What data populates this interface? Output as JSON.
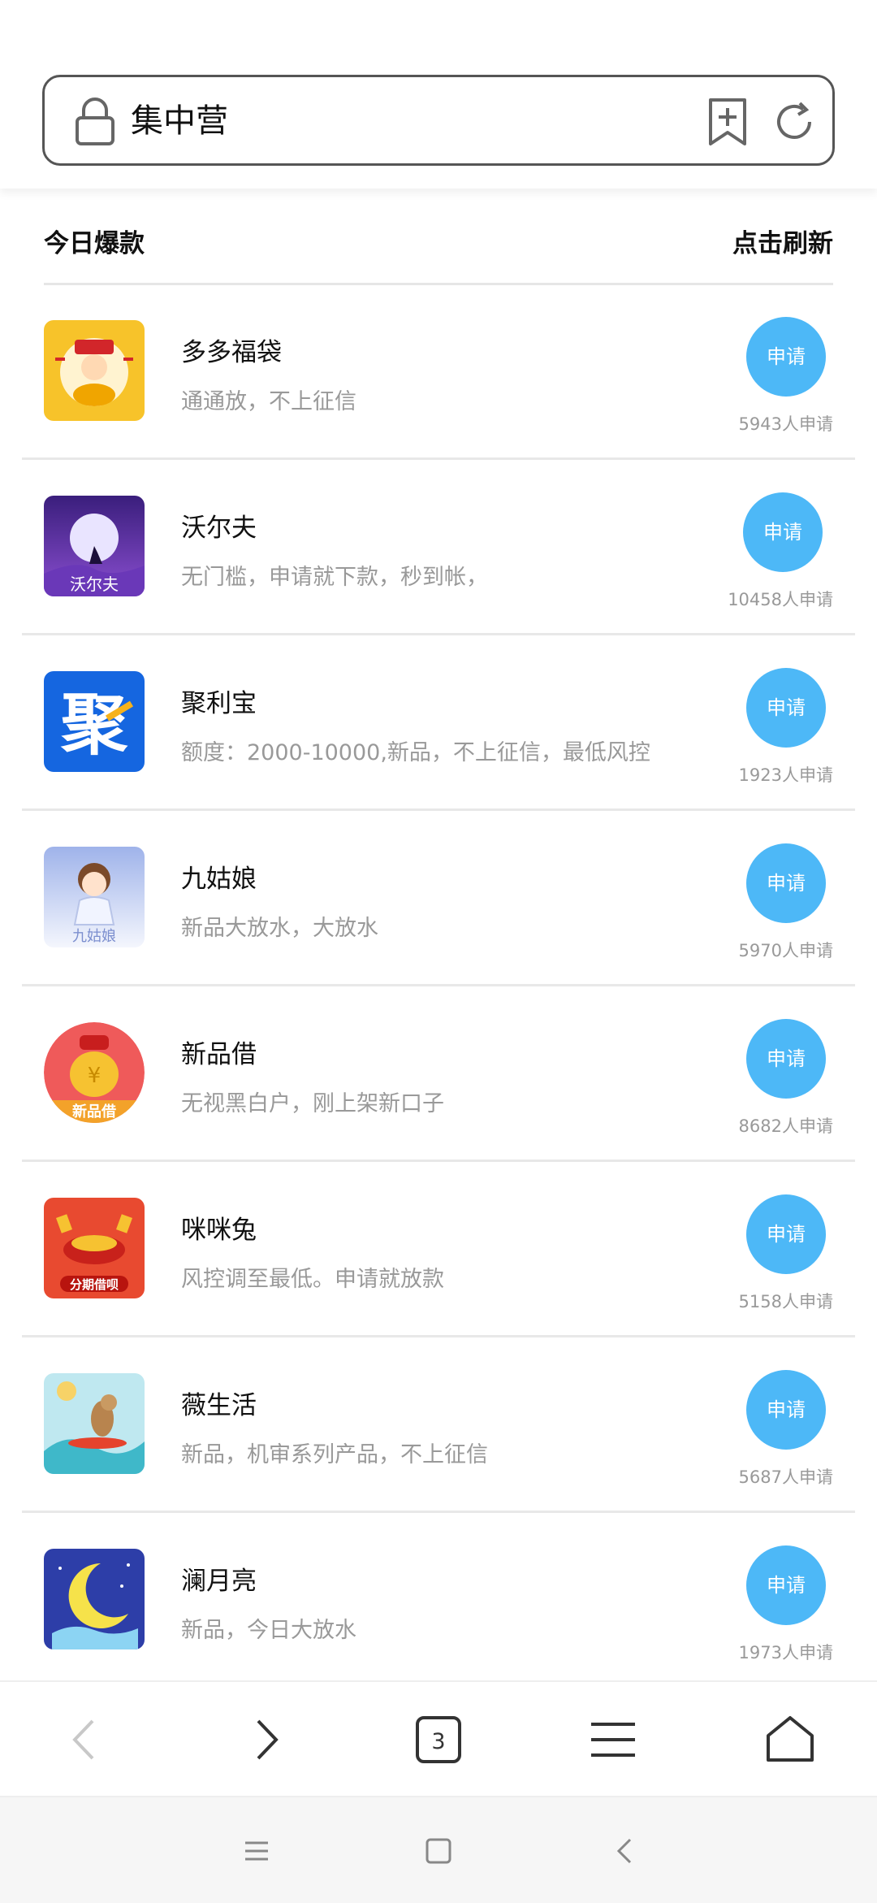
{
  "address_bar": {
    "title": "集中营"
  },
  "section": {
    "title": "今日爆款",
    "refresh_label": "点击刷新"
  },
  "items": [
    {
      "name": "多多福袋",
      "desc": "通通放，不上征信",
      "button": "申请",
      "count": "5943人申请",
      "logo": "fortune-god-logo",
      "logo_bg": "#f7c32a"
    },
    {
      "name": "沃尔夫",
      "desc": "无门槛，申请就下款，秒到帐，",
      "button": "申请",
      "count": "10458人申请",
      "logo": "wolf-moon-logo",
      "logo_bg": "#5a2d9c",
      "logo_text": "沃尔夫"
    },
    {
      "name": "聚利宝",
      "desc": "额度：2000-10000,新品，不上征信，最低风控",
      "button": "申请",
      "count": "1923人申请",
      "logo": "ju-character-logo",
      "logo_bg": "#1566e0",
      "logo_text": "聚"
    },
    {
      "name": "九姑娘",
      "desc": "新品大放水，大放水",
      "button": "申请",
      "count": "5970人申请",
      "logo": "girl-logo",
      "logo_bg": "#c9d6f5",
      "logo_text": "九姑娘"
    },
    {
      "name": "新品借",
      "desc": "无视黑白户，刚上架新口子",
      "button": "申请",
      "count": "8682人申请",
      "logo": "money-bag-logo",
      "logo_bg": "#ef5a5a",
      "logo_text": "新品借"
    },
    {
      "name": "咪咪兔",
      "desc": "风控调至最低。申请就放款",
      "button": "申请",
      "count": "5158人申请",
      "logo": "red-envelope-logo",
      "logo_bg": "#e84a30",
      "logo_text": "分期借呗"
    },
    {
      "name": "薇生活",
      "desc": "新品，机审系列产品，不上征信",
      "button": "申请",
      "count": "5687人申请",
      "logo": "surfing-dog-logo",
      "logo_bg": "#bfe8f0"
    },
    {
      "name": "澜月亮",
      "desc": "新品，今日大放水",
      "button": "申请",
      "count": "1973人申请",
      "logo": "moon-logo",
      "logo_bg": "#2d3ea8"
    }
  ],
  "toolbar": {
    "tab_count": "3"
  }
}
